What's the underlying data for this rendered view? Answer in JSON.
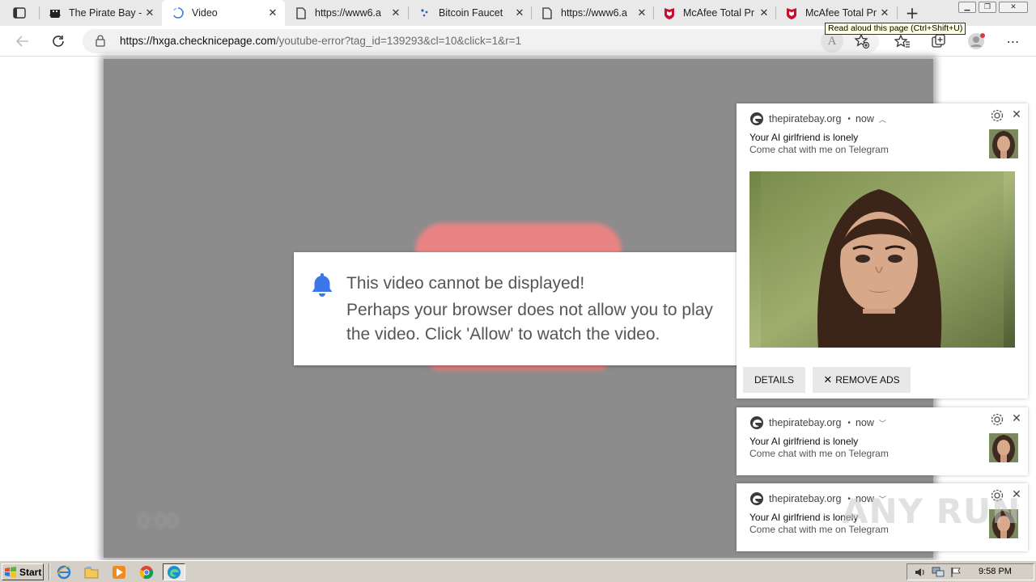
{
  "browser": {
    "tabs": [
      {
        "title": "The Pirate Bay -",
        "icon": "pirate-ship-icon",
        "active": false
      },
      {
        "title": "Video",
        "icon": "loading-icon",
        "active": true
      },
      {
        "title": "https://www6.a",
        "icon": "page-icon",
        "active": false
      },
      {
        "title": "Bitcoin Faucet",
        "icon": "faucet-icon",
        "active": false
      },
      {
        "title": "https://www6.a",
        "icon": "page-icon",
        "active": false
      },
      {
        "title": "McAfee Total Pr",
        "icon": "mcafee-icon",
        "active": false
      },
      {
        "title": "McAfee Total Pr",
        "icon": "mcafee-icon",
        "active": false
      }
    ],
    "url_host": "https://hxga.checknicepage.com",
    "url_path": "/youtube-error?tag_id=139293&cl=10&click=1&r=1",
    "tooltip": "Read aloud this page (Ctrl+Shift+U)",
    "read_aloud_label": "A"
  },
  "page": {
    "timecode": "0:00",
    "dialog": {
      "line1": "This video cannot be displayed!",
      "line2": "Perhaps your browser does not allow you to play the video. Click 'Allow' to watch the video."
    }
  },
  "notifications": [
    {
      "source": "thepiratebay.org",
      "time": "now",
      "expanded": true,
      "heading": "Your AI girlfriend is lonely",
      "body": "Come chat with me on Telegram",
      "details_label": "DETAILS",
      "remove_ads_label": "REMOVE ADS"
    },
    {
      "source": "thepiratebay.org",
      "time": "now",
      "expanded": false,
      "heading": "Your AI girlfriend is lonely",
      "body": "Come chat with me on Telegram"
    },
    {
      "source": "thepiratebay.org",
      "time": "now",
      "expanded": false,
      "heading": "Your AI girlfriend is lonely",
      "body": "Come chat with me on Telegram"
    }
  ],
  "watermark": "ANY RUN",
  "taskbar": {
    "start_label": "Start",
    "clock": "9:58 PM"
  },
  "colors": {
    "accent_blue": "#3b78e7",
    "video_gray": "#8c8c8c",
    "blurred_red": "#e98383"
  }
}
